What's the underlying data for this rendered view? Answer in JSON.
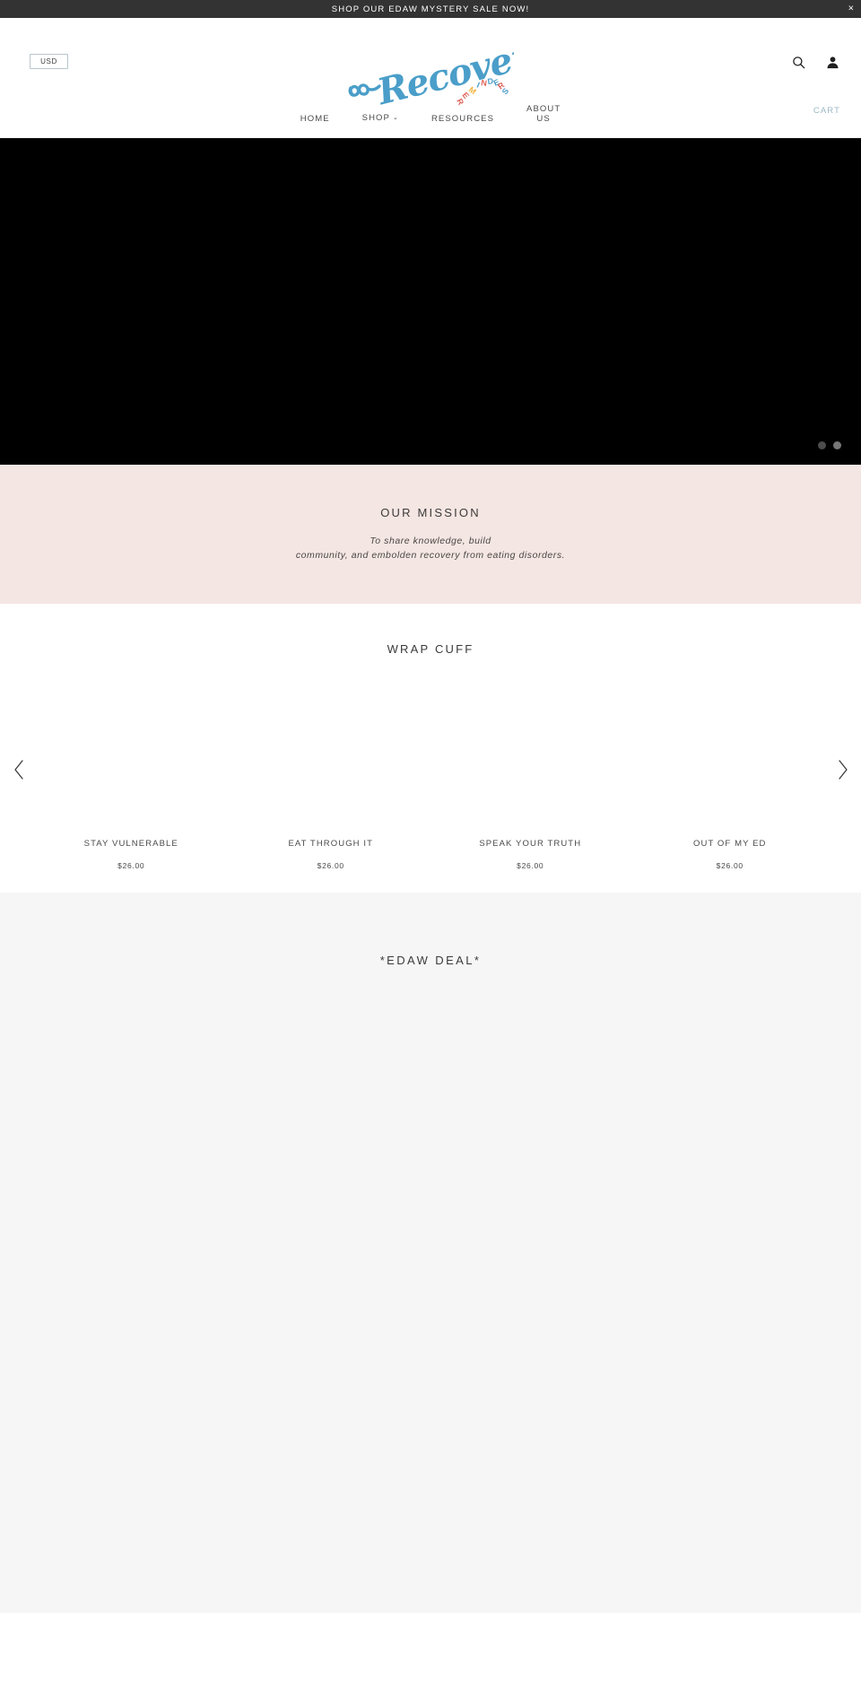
{
  "announcement": {
    "text": "SHOP OUR EDAW MYSTERY SALE NOW!",
    "close_label": "×"
  },
  "header": {
    "currency": {
      "selected": "USD",
      "options": [
        "USD"
      ]
    },
    "logo": {
      "script_text": "Recovery",
      "arc_text": "REMINDERS",
      "script_color": "#4a9ec9",
      "arc_letter_colors": [
        "#e0635a",
        "#e0635a",
        "#f0b43f",
        "#4a9ec9",
        "#e0635a",
        "#4a9ec9",
        "#4a9ec9",
        "#e0635a",
        "#4a9ec9"
      ]
    },
    "icons": {
      "search": "search-icon",
      "account": "user-icon"
    }
  },
  "nav": {
    "items": [
      {
        "label": "HOME",
        "has_dropdown": false
      },
      {
        "label": "SHOP",
        "has_dropdown": true,
        "caret": "⌄"
      },
      {
        "label": "RESOURCES",
        "has_dropdown": false
      },
      {
        "label": "ABOUT US",
        "has_dropdown": false,
        "line1": "ABOUT",
        "line2": "US"
      }
    ],
    "cart_label": "CART",
    "cart_color": "#9bb8c4"
  },
  "hero": {
    "background_color": "#000000",
    "slides": [
      {
        "index": 1,
        "active": false
      },
      {
        "index": 2,
        "active": true
      }
    ]
  },
  "mission": {
    "title": "OUR MISSION",
    "line1": "To share knowledge, build",
    "line2": "community, and embolden recovery from eating disorders.",
    "background_color": "#f4e6e3"
  },
  "products_section": {
    "title": "WRAP CUFF",
    "prev_arrow": "‹",
    "next_arrow": "›",
    "items": [
      {
        "title": "STAY VULNERABLE",
        "price": "$26.00"
      },
      {
        "title": "EAT THROUGH IT",
        "price": "$26.00"
      },
      {
        "title": "SPEAK YOUR TRUTH",
        "price": "$26.00"
      },
      {
        "title": "OUT OF MY ED",
        "price": "$26.00"
      }
    ]
  },
  "edaw_section": {
    "title": "*EDAW DEAL*",
    "background_color": "#f6f6f6"
  }
}
